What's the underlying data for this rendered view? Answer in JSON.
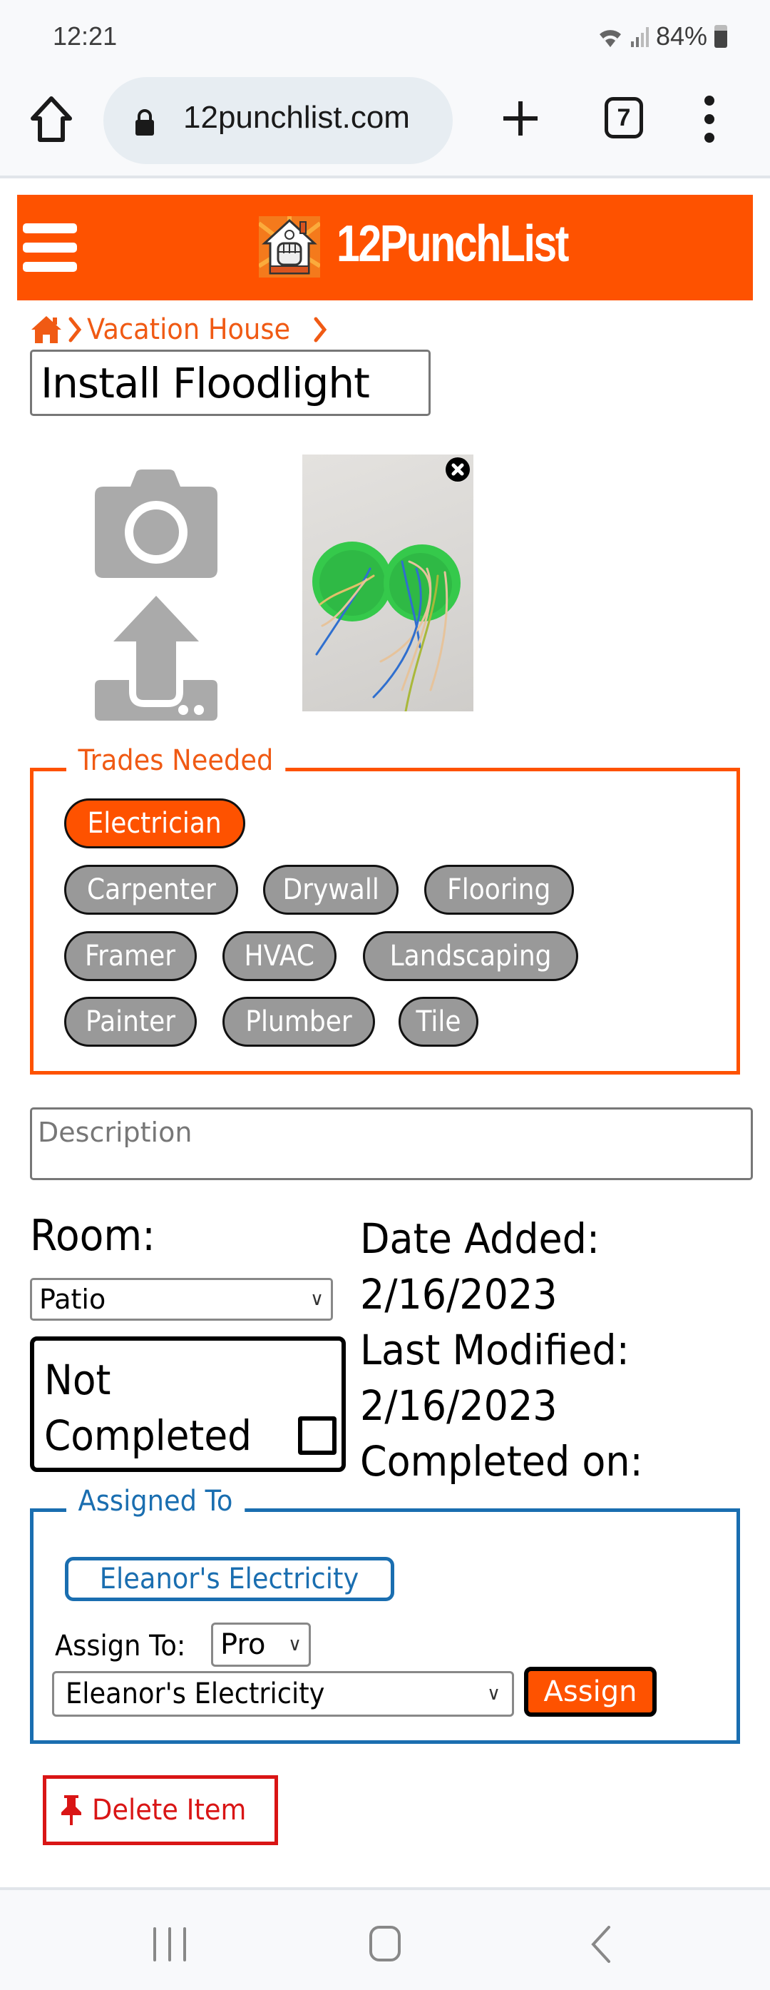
{
  "status_bar": {
    "time": "12:21",
    "battery": "84%",
    "icons": [
      "wifi-icon",
      "signal-icon",
      "battery-icon"
    ]
  },
  "browser": {
    "url": "12punchlist.com",
    "tab_count": "7",
    "icons": [
      "home-icon",
      "lock-icon",
      "new-tab-icon",
      "tabs-icon",
      "menu-icon"
    ]
  },
  "header": {
    "brand": "12PunchList",
    "brand_color": "#fe5200",
    "icons": [
      "hamburger-icon",
      "logo-icon"
    ]
  },
  "breadcrumb": {
    "items": [
      {
        "label": "",
        "icon": "home-icon"
      },
      {
        "label": "Vacation House"
      }
    ]
  },
  "item": {
    "title": "Install Floodlight",
    "photo_alt": "Green electrical junction boxes with wires"
  },
  "trades": {
    "legend": "Trades Needed",
    "selected": [
      "Electrician"
    ],
    "items": [
      {
        "label": "Electrician",
        "active": true
      },
      {
        "label": "Carpenter",
        "active": false
      },
      {
        "label": "Drywall",
        "active": false
      },
      {
        "label": "Flooring",
        "active": false
      },
      {
        "label": "Framer",
        "active": false
      },
      {
        "label": "HVAC",
        "active": false
      },
      {
        "label": "Landscaping",
        "active": false
      },
      {
        "label": "Painter",
        "active": false
      },
      {
        "label": "Plumber",
        "active": false
      },
      {
        "label": "Tile",
        "active": false
      }
    ]
  },
  "description": {
    "placeholder": "Description",
    "value": ""
  },
  "room": {
    "label": "Room:",
    "selected": "Patio"
  },
  "completion": {
    "label_line1": "Not",
    "label_line2": "Completed",
    "checked": false
  },
  "dates": {
    "added_label": "Date Added:",
    "added_value": "2/16/2023",
    "modified_label": "Last Modified:",
    "modified_value": "2/16/2023",
    "completed_label": "Completed on:",
    "completed_value": ""
  },
  "assigned": {
    "legend": "Assigned To",
    "current_assignee": "Eleanor's Electricity",
    "assign_to_label": "Assign To:",
    "type_selected": "Pro",
    "pro_selected": "Eleanor's Electricity",
    "assign_button": "Assign",
    "accent_color": "#1a6eb0"
  },
  "delete": {
    "label": "Delete Item",
    "icon": "pin-icon",
    "color": "#d91515"
  },
  "nav_bar": {
    "icons": [
      "recent-apps-icon",
      "home-nav-icon",
      "back-icon"
    ]
  }
}
